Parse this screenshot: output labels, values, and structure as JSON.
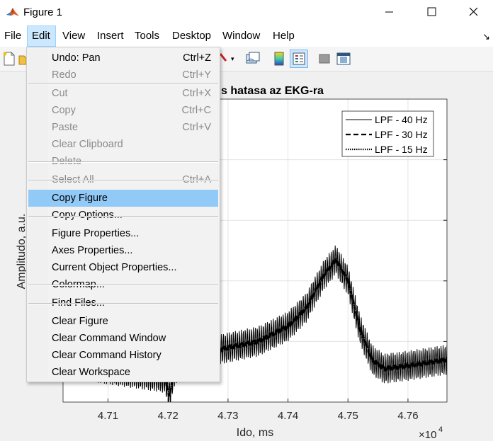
{
  "window": {
    "title": "Figure 1",
    "minimize_icon": "minimize-icon",
    "maximize_icon": "maximize-icon",
    "close_icon": "close-icon"
  },
  "menubar": {
    "items": [
      "File",
      "Edit",
      "View",
      "Insert",
      "Tools",
      "Desktop",
      "Window",
      "Help"
    ],
    "active": "Edit",
    "dock_arrow": "↘"
  },
  "edit_menu": {
    "items": [
      {
        "label": "Undo: Pan",
        "shortcut": "Ctrl+Z",
        "enabled": true
      },
      {
        "label": "Redo",
        "shortcut": "Ctrl+Y",
        "enabled": false
      },
      {
        "label": "Cut",
        "shortcut": "Ctrl+X",
        "enabled": false
      },
      {
        "label": "Copy",
        "shortcut": "Ctrl+C",
        "enabled": false
      },
      {
        "label": "Paste",
        "shortcut": "Ctrl+V",
        "enabled": false
      },
      {
        "label": "Clear Clipboard",
        "shortcut": "",
        "enabled": false
      },
      {
        "label": "Delete",
        "shortcut": "",
        "enabled": false
      },
      {
        "label": "Select All",
        "shortcut": "Ctrl+A",
        "enabled": false
      },
      {
        "label": "Copy Figure",
        "shortcut": "",
        "enabled": true,
        "highlighted": true
      },
      {
        "label": "Copy Options...",
        "shortcut": "",
        "enabled": true
      },
      {
        "label": "Figure Properties...",
        "shortcut": "",
        "enabled": true
      },
      {
        "label": "Axes Properties...",
        "shortcut": "",
        "enabled": true
      },
      {
        "label": "Current Object Properties...",
        "shortcut": "",
        "enabled": true
      },
      {
        "label": "Colormap...",
        "shortcut": "",
        "enabled": true
      },
      {
        "label": "Find Files...",
        "shortcut": "",
        "enabled": true
      },
      {
        "label": "Clear Figure",
        "shortcut": "",
        "enabled": true
      },
      {
        "label": "Clear Command Window",
        "shortcut": "",
        "enabled": true
      },
      {
        "label": "Clear Command History",
        "shortcut": "",
        "enabled": true
      },
      {
        "label": "Clear Workspace",
        "shortcut": "",
        "enabled": true
      }
    ]
  },
  "toolbar": {
    "icons": [
      "new-figure-icon",
      "open-file-icon",
      "brush-icon",
      "link-plot-icon",
      "colorbar-icon",
      "legend-icon",
      "hide-plot-tools-icon",
      "show-plot-tools-icon"
    ]
  },
  "plot": {
    "title_visible": "s hatasa az EKG-ra",
    "xlabel": "Ido, ms",
    "ylabel": "Amplitudo, a.u.",
    "x_ticks": [
      "4.71",
      "4.72",
      "4.73",
      "4.74",
      "4.75",
      "4.76"
    ],
    "x_exponent_base": "×10",
    "x_exponent_power": "4",
    "legend": [
      "LPF - 40 Hz",
      "LPF - 30 Hz",
      "LPF - 15 Hz"
    ]
  },
  "chart_data": {
    "type": "line",
    "title": "s hatasa az EKG-ra",
    "xlabel": "Ido, ms",
    "ylabel": "Amplitudo, a.u.",
    "x_scale_factor": 10000,
    "xlim": [
      4.7025,
      4.7665
    ],
    "ylim": [
      0,
      1
    ],
    "grid": true,
    "legend_position": "top-right",
    "series": [
      {
        "name": "LPF - 40 Hz",
        "style": "solid",
        "x": [
          4.7025,
          4.7195,
          4.7202,
          4.721,
          4.723,
          4.726,
          4.73,
          4.735,
          4.74,
          4.743,
          4.746,
          4.748,
          4.75,
          4.752,
          4.754,
          4.756,
          4.76,
          4.7665
        ],
        "y": [
          0.13,
          0.08,
          0.02,
          0.1,
          0.15,
          0.16,
          0.18,
          0.2,
          0.25,
          0.31,
          0.42,
          0.47,
          0.4,
          0.24,
          0.14,
          0.11,
          0.12,
          0.14
        ]
      },
      {
        "name": "LPF - 30 Hz",
        "style": "dashed",
        "x": [
          4.7025,
          4.7195,
          4.7202,
          4.721,
          4.723,
          4.726,
          4.73,
          4.735,
          4.74,
          4.743,
          4.746,
          4.748,
          4.75,
          4.752,
          4.754,
          4.756,
          4.76,
          4.7665
        ],
        "y": [
          0.13,
          0.08,
          0.02,
          0.1,
          0.15,
          0.16,
          0.18,
          0.2,
          0.25,
          0.31,
          0.42,
          0.47,
          0.4,
          0.24,
          0.14,
          0.11,
          0.12,
          0.14
        ]
      },
      {
        "name": "LPF - 15 Hz",
        "style": "dotted",
        "x": [
          4.7025,
          4.7195,
          4.7202,
          4.721,
          4.723,
          4.726,
          4.73,
          4.735,
          4.74,
          4.743,
          4.746,
          4.748,
          4.75,
          4.752,
          4.754,
          4.756,
          4.76,
          4.7665
        ],
        "y": [
          0.13,
          0.08,
          0.02,
          0.1,
          0.15,
          0.16,
          0.18,
          0.2,
          0.25,
          0.31,
          0.42,
          0.47,
          0.4,
          0.24,
          0.14,
          0.11,
          0.12,
          0.14
        ]
      }
    ]
  }
}
